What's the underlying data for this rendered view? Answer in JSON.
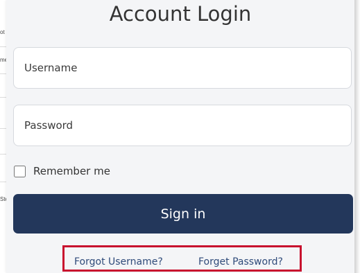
{
  "modal": {
    "title": "Account Login"
  },
  "form": {
    "username_placeholder": "Username",
    "password_placeholder": "Password",
    "remember_label": "Remember me",
    "remember_checked": false,
    "signin_label": "Sign in"
  },
  "links": {
    "forgot_username": "Forgot Username?",
    "forgot_password": "Forget Password?"
  },
  "background_fragments": [
    "ot u",
    "me",
    "Ste"
  ],
  "colors": {
    "modal_bg": "#f4f5f7",
    "signin_bg": "#23375b",
    "link": "#2f4b7a",
    "highlight": "#c8102e"
  }
}
